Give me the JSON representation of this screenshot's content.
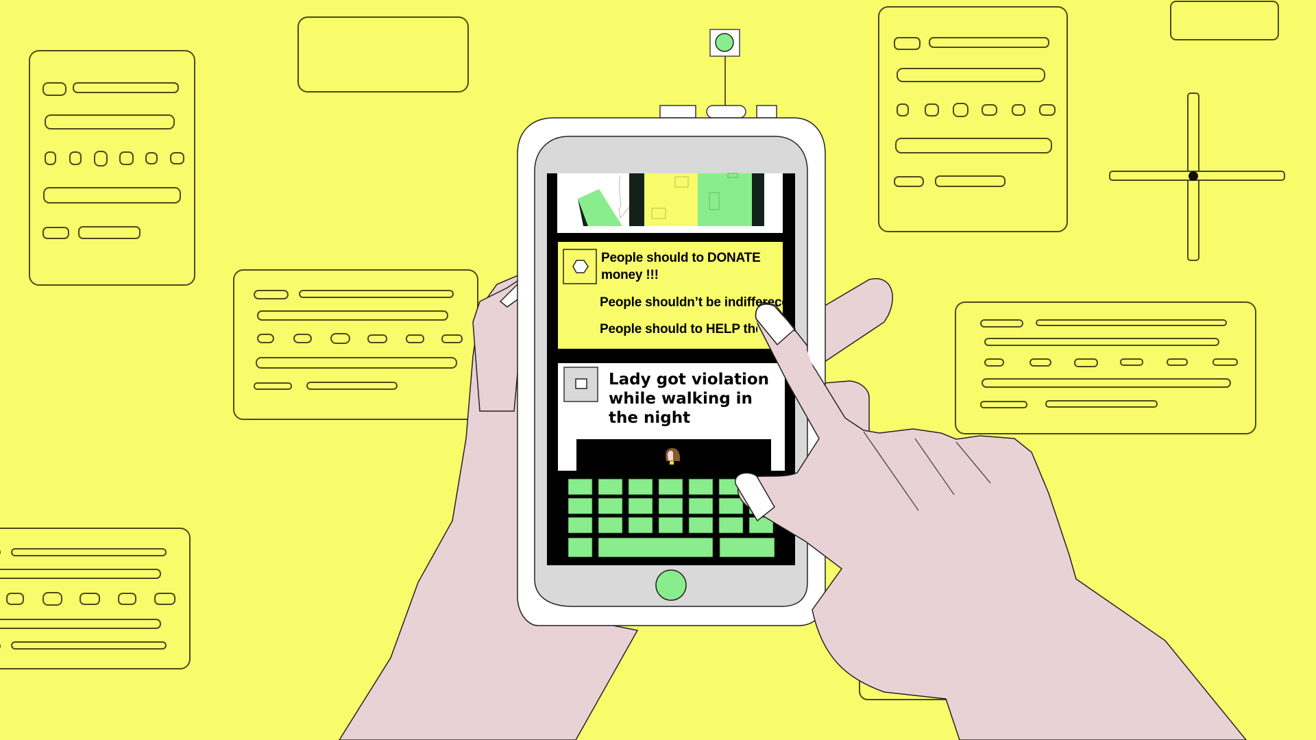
{
  "scene": {
    "description": "Illustration of hands holding a smartphone showing a social feed over a yellow background of wireframe UI cards",
    "colors": {
      "background": "#f8fc6b",
      "accent_green": "#8aed8d",
      "skin": "#e9d2d6",
      "phone_body": "#ffffff",
      "phone_bezel": "#d9d9d9",
      "screen_black": "#000000"
    }
  },
  "phone": {
    "antenna_icon": "green-circle-signal",
    "home_button_icon": "green-circle",
    "feed": {
      "image_strip": {
        "panels": [
          "white-with-green-block",
          "dark",
          "yellow",
          "green",
          "dark"
        ]
      },
      "post_1": {
        "icon": "hexagon-icon",
        "lines": [
          "People should to DONATE",
          "money !!!",
          "People shouldn’t be indifferece!",
          "People should to HELP the"
        ]
      },
      "post_2": {
        "icon": "square-icon",
        "headline_lines": [
          "Lady got violation",
          "while walking in",
          "the night"
        ],
        "image": "woman-figure-in-dark"
      }
    },
    "keyboard": {
      "rows": 4,
      "keys_per_row": 7
    }
  }
}
